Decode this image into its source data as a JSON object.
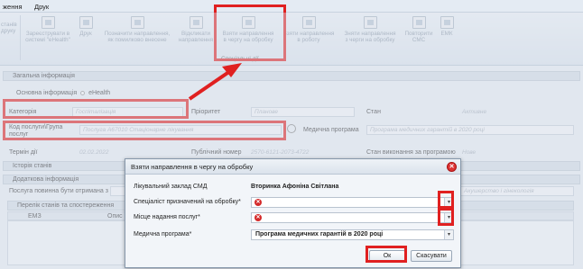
{
  "menu": {
    "item1": "ження",
    "item2": "Друк"
  },
  "ribbon": {
    "left_partial_1": "станів",
    "left_partial_2": "друку",
    "buttons": [
      {
        "label1": "Зареєструвати в",
        "label2": "системі \"eHealth\""
      },
      {
        "label1": "Друк",
        "label2": ""
      },
      {
        "label1": "Позначити направлення,",
        "label2": "як помилково внесене"
      },
      {
        "label1": "Відкликати",
        "label2": "направлення"
      },
      {
        "label1": "Взяти направлення",
        "label2": "в чергу на обробку"
      },
      {
        "label1": "Взяти направлення",
        "label2": "в роботу"
      },
      {
        "label1": "Зняти направлення",
        "label2": "з черги на обробку"
      },
      {
        "label1": "Повторити",
        "label2": "СМС"
      },
      {
        "label1": "ЕМК",
        "label2": ""
      }
    ],
    "group_label": "Спеціальні дії"
  },
  "form": {
    "general_section": "Загальна інформація",
    "tab_main": "Основна інформація",
    "tab_ehealth": "eHealth",
    "category_label": "Категорія",
    "category_value": "Госпіталізація",
    "priority_label": "Пріоритет",
    "priority_value": "Планове",
    "state_label": "Стан",
    "state_value": "Активне",
    "service_code_label": "Код послуги\\Група послуг",
    "service_code_value": "Послуга А67010 Стаціонарне лікування",
    "med_program_label": "Медична програма",
    "med_program_value": "Програма медичних гарантій в 2020 році",
    "term_label": "Термін дії",
    "term_value": "02.02.2022",
    "public_number_label": "Публічний номер",
    "public_number_value": "2570-6121-2073-4722",
    "program_state_label": "Стан виконання за програмою",
    "program_state_value": "Нове",
    "history_section": "Історія станів",
    "additional_section": "Додаткова інформація",
    "service_received_label": "Послуга повинна бути отримана з",
    "specialty_value": "Акушерство і гінекологія",
    "list_section": "Перелік станів та спостереження",
    "col_emz": "ЕМЗ",
    "col_opys": "Опис"
  },
  "dialog": {
    "title": "Взяти направлення в чергу на обробку",
    "facility_label": "Лікувальний заклад СМД",
    "facility_value": "Вторинка Афоніна Світлана",
    "specialist_label": "Спеціаліст призначений на обробку*",
    "place_label": "Місце надання послуг*",
    "program_label": "Медична програма*",
    "program_value": "Програма медичних гарантій в 2020 році",
    "ok_label": "Ок",
    "cancel_label": "Скасувати"
  },
  "colors": {
    "highlight": "#e02020",
    "error_icon": "#d42a2a"
  }
}
